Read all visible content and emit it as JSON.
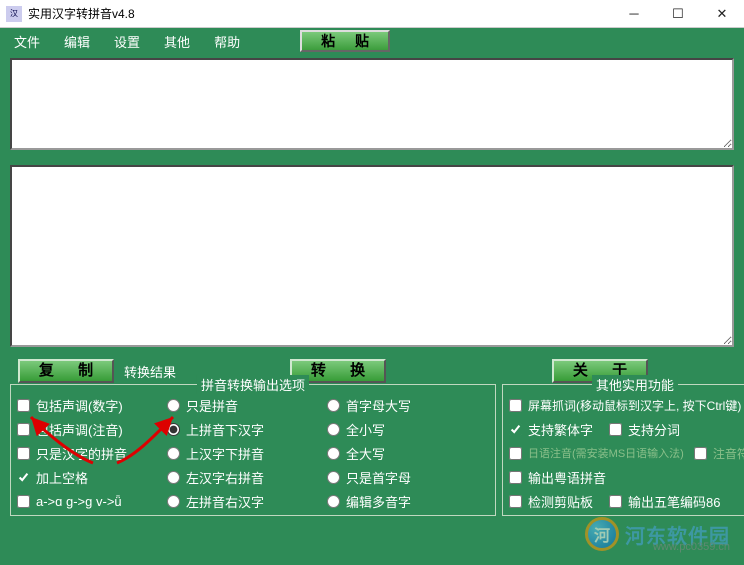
{
  "window": {
    "title": "实用汉字转拼音v4.8"
  },
  "menu": {
    "file": "文件",
    "edit": "编辑",
    "settings": "设置",
    "other": "其他",
    "help": "帮助",
    "paste": "粘 贴"
  },
  "actions": {
    "copy": "复 制",
    "result_label": "转换结果",
    "convert": "转 换",
    "about": "关 于"
  },
  "group_left": {
    "legend": "拼音转换输出选项",
    "colA": {
      "opt0": "包括声调(数字)",
      "opt1": "包括声调(注音)",
      "opt2": "只是汉字的拼音",
      "opt3": "加上空格",
      "opt4": "a->ɑ g->ɡ v->ǖ"
    },
    "colB": {
      "opt0": "只是拼音",
      "opt1": "上拼音下汉字",
      "opt2": "上汉字下拼音",
      "opt3": "左汉字右拼音",
      "opt4": "左拼音右汉字"
    },
    "colC": {
      "opt0": "首字母大写",
      "opt1": "全小写",
      "opt2": "全大写",
      "opt3": "只是首字母",
      "opt4": "编辑多音字"
    }
  },
  "group_right": {
    "legend": "其他实用功能",
    "r0a": "屏幕抓词(移动鼠标到汉字上, 按下Ctrl键)",
    "r1a": "支持繁体字",
    "r1b": "支持分词",
    "r2a": "日语注音(需安装MS日语输入法)",
    "r2b": "注音符号",
    "r3a": "输出粤语拼音",
    "r4a": "检测剪贴板",
    "r4b": "输出五笔编码86"
  },
  "watermark": {
    "text": "河东软件园",
    "url": "www.pc0359.cn"
  }
}
